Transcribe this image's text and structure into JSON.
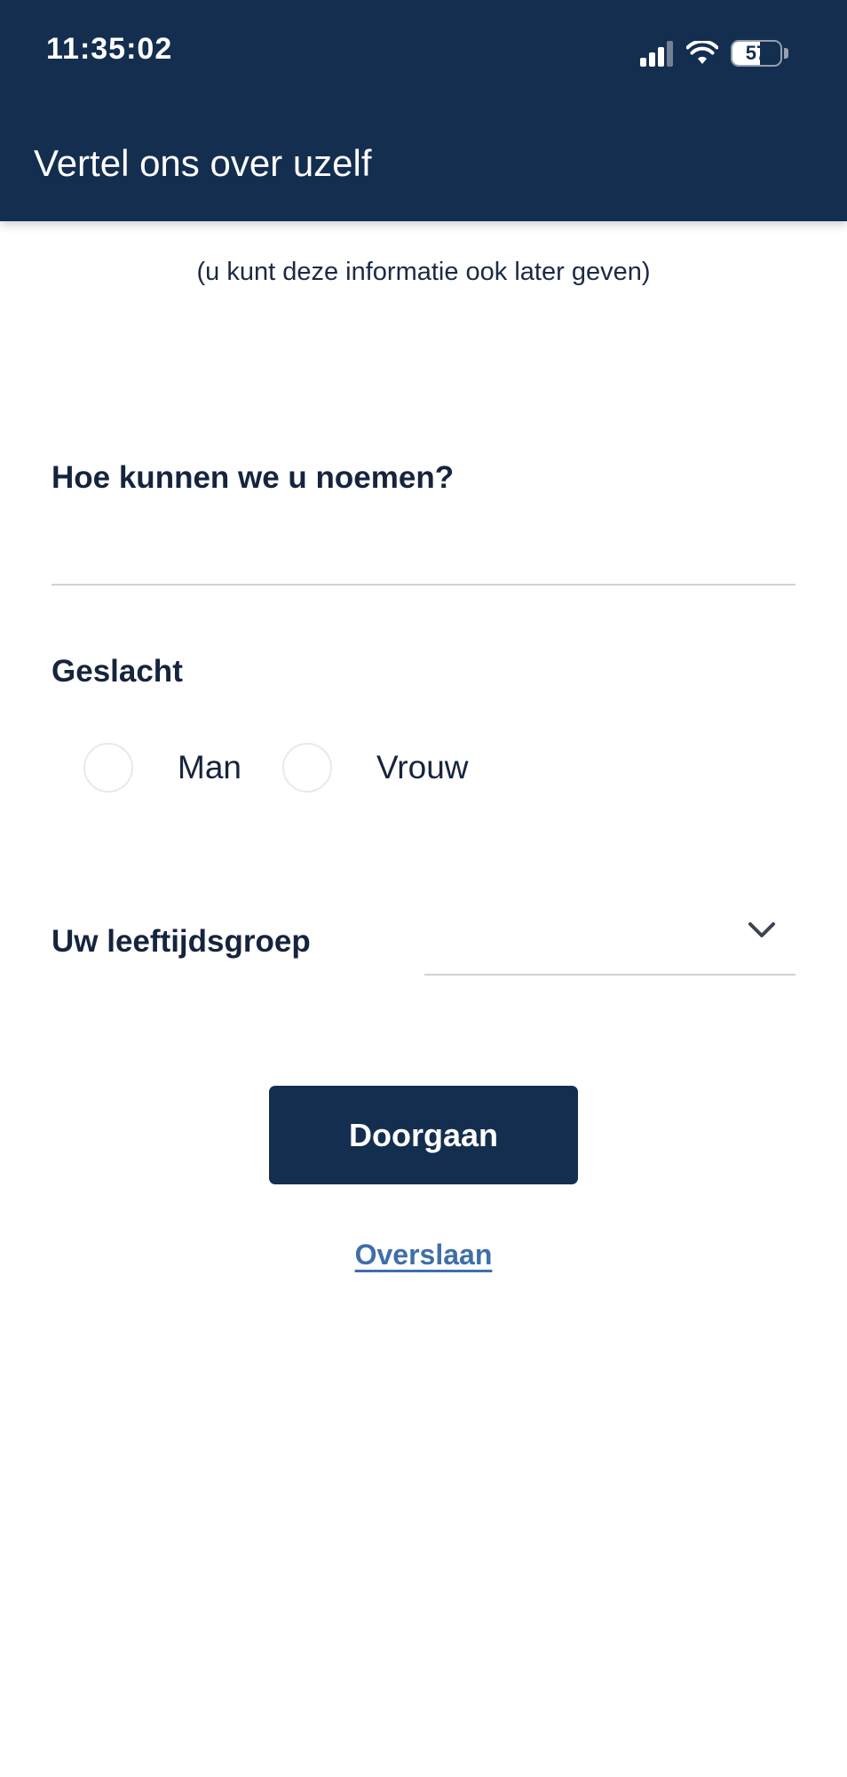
{
  "status_bar": {
    "time": "11:35:02",
    "battery_level": "57",
    "battery_fraction": 0.57,
    "signal_icon": "cellular-signal-icon",
    "wifi_icon": "wifi-icon"
  },
  "header": {
    "title": "Vertel ons over uzelf",
    "background_color": "#142e4f"
  },
  "main": {
    "subtitle": "(u kunt deze informatie ook later geven)",
    "name_field": {
      "label": "Hoe kunnen we u noemen?",
      "value": "",
      "placeholder": ""
    },
    "gender": {
      "label": "Geslacht",
      "options": [
        "Man",
        "Vrouw"
      ],
      "selected": null
    },
    "age_group": {
      "label": "Uw leeftijdsgroep",
      "selected_value": "",
      "icon": "chevron-down-icon"
    },
    "continue_label": "Doorgaan",
    "skip_label": "Overslaan"
  },
  "colors": {
    "primary": "#142e4f",
    "link": "#3f6fa8",
    "text": "#16243d"
  }
}
